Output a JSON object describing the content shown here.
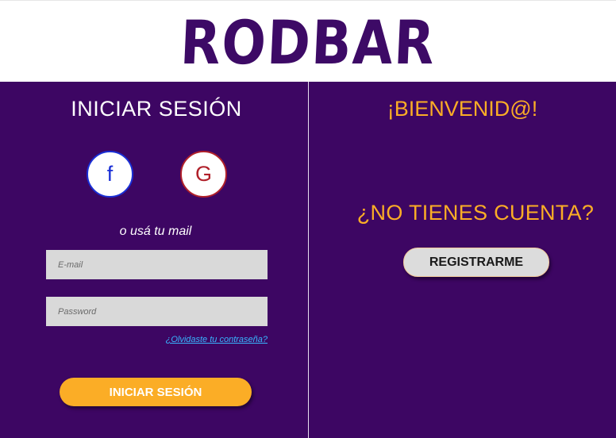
{
  "header": {
    "logo_text": "RODBAR"
  },
  "login": {
    "title": "INICIAR SESIÓN",
    "facebook_label": "f",
    "google_label": "G",
    "or_text": "o usá tu mail",
    "email_placeholder": "E-mail",
    "password_placeholder": "Password",
    "forgot_link": "¿Olvidaste tu contraseña?",
    "submit_label": "INICIAR SESIÓN"
  },
  "register": {
    "welcome": "¡BIENVENID@!",
    "question": "¿NO TIENES CUENTA?",
    "button_label": "REGISTRARME"
  },
  "colors": {
    "brand_purple": "#3d0663",
    "accent_orange": "#fbad26",
    "facebook_blue": "#1a2fd6",
    "google_red": "#b0202a",
    "link_blue": "#38b6ff"
  }
}
